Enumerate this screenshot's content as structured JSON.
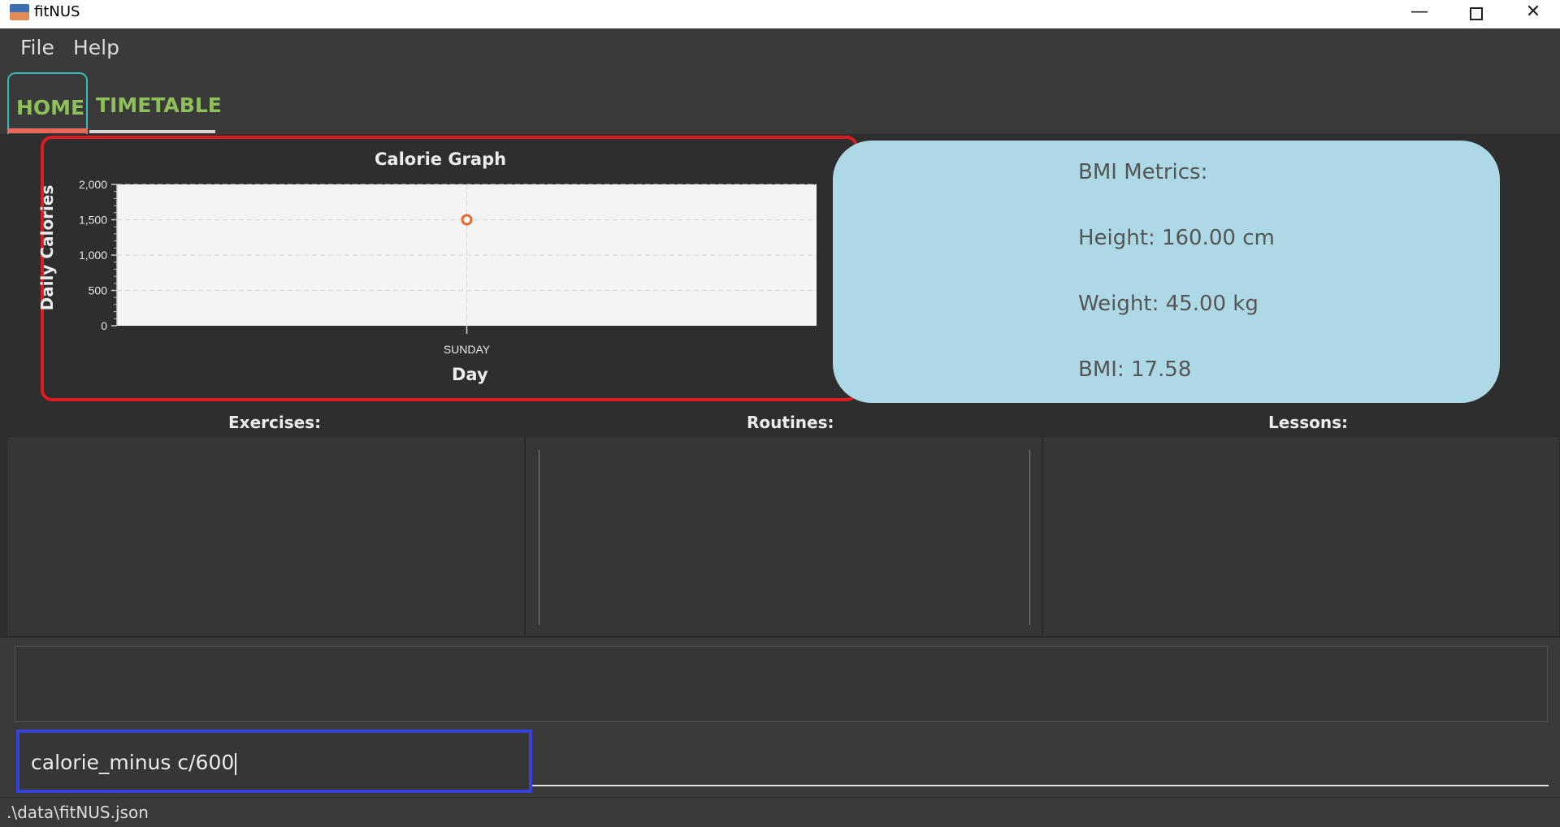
{
  "window": {
    "title": "fitNUS",
    "minimize_glyph": "—",
    "close_glyph": "✕"
  },
  "menu": {
    "file_label": "File",
    "help_label": "Help"
  },
  "tabs": {
    "home_label": "HOME",
    "timetable_label": "TIMETABLE"
  },
  "chart_data": {
    "type": "line",
    "title": "Calorie Graph",
    "xlabel": "Day",
    "ylabel": "Daily Calories",
    "categories": [
      "SUNDAY"
    ],
    "values": [
      1500
    ],
    "ylim": [
      0,
      2000
    ],
    "yticks": [
      "2,000",
      "1,500",
      "1,000",
      "500",
      "0"
    ],
    "grid": true,
    "series_color": "#e8692a"
  },
  "bmi": {
    "title": "BMI Metrics:",
    "height": "Height: 160.00 cm",
    "weight": "Weight: 45.00 kg",
    "bmi": "BMI: 17.58"
  },
  "columns": {
    "exercises_header": "Exercises:",
    "routines_header": "Routines:",
    "lessons_header": "Lessons:"
  },
  "result_display": "",
  "command": {
    "value": "calorie_minus c/600"
  },
  "status": {
    "file_path": ".\\data\\fitNUS.json"
  }
}
